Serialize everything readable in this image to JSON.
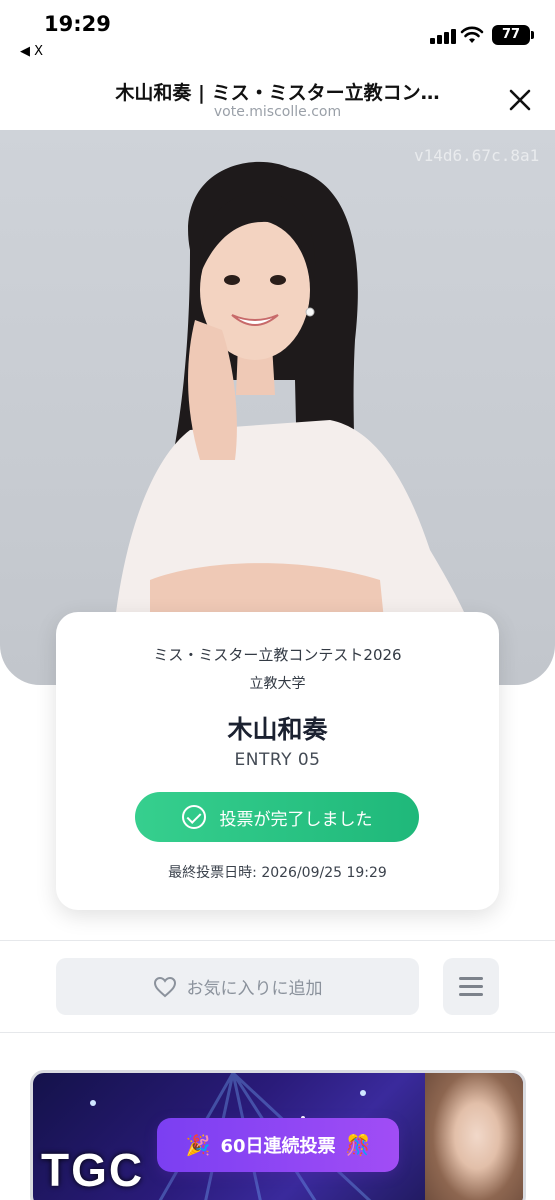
{
  "status_bar": {
    "time": "19:29",
    "back_app": "◀ X",
    "battery": "77"
  },
  "browser": {
    "title": "木山和奏 | ミス・ミスター立教コン…",
    "url": "vote.miscolle.com"
  },
  "hero": {
    "watermark": "v14d6.67c.8a1"
  },
  "card": {
    "contest": "ミス・ミスター立教コンテスト2026",
    "university": "立教大学",
    "name": "木山和奏",
    "entry": "ENTRY 05",
    "vote_status": "投票が完了しました",
    "last_vote": "最終投票日時: 2026/09/25 19:29"
  },
  "actions": {
    "favorite": "お気に入りに追加"
  },
  "banner": {
    "logo": "TGC",
    "streak": "60日連続投票"
  },
  "colors": {
    "accent_green": "#22bb7d",
    "streak_purple": "#8a44f4"
  }
}
